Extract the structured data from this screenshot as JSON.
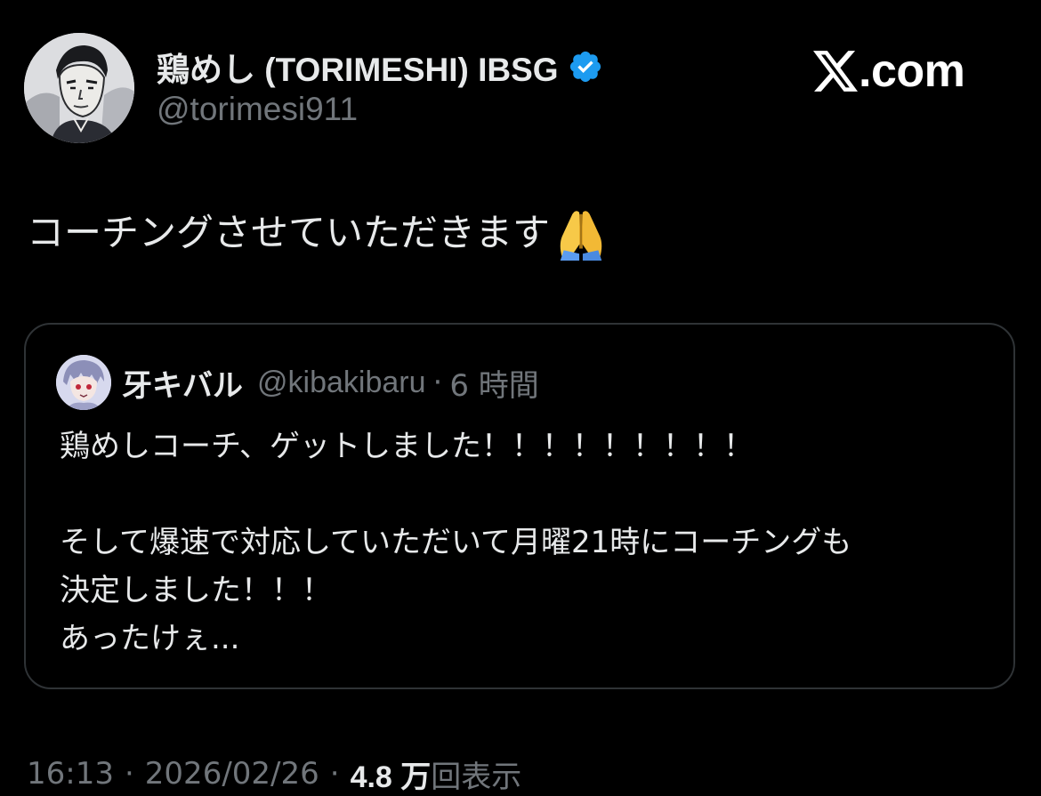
{
  "brand": {
    "logo_text": ".com",
    "logo_color": "#ffffff"
  },
  "author": {
    "display_name": "鶏めし (TORIMESHI) IBSG",
    "handle": "@torimesi911",
    "verified": true,
    "verified_icon": "verified-badge-icon",
    "verified_color": "#1d9bf0"
  },
  "tweet": {
    "text": "コーチングさせていただきます",
    "emoji_icon": "folded-hands-emoji"
  },
  "quote": {
    "display_name": "牙キバル",
    "handle": "@kibakibaru",
    "separator": "·",
    "time": "6 時間",
    "lines": [
      "鶏めしコーチ、ゲットしました！！！！！！！！！",
      "",
      "そして爆速で対応していただいて月曜21時にコーチングも",
      "決定しました！！！",
      "あったけぇ..."
    ]
  },
  "meta": {
    "time": "16:13",
    "separator": "·",
    "date": "2026/02/26",
    "views_count": "4.8 万",
    "views_label": "回表示"
  },
  "colors": {
    "background": "#000000",
    "primary_text": "#e7e9ea",
    "secondary_text": "#71767b",
    "border": "#2f3336"
  }
}
